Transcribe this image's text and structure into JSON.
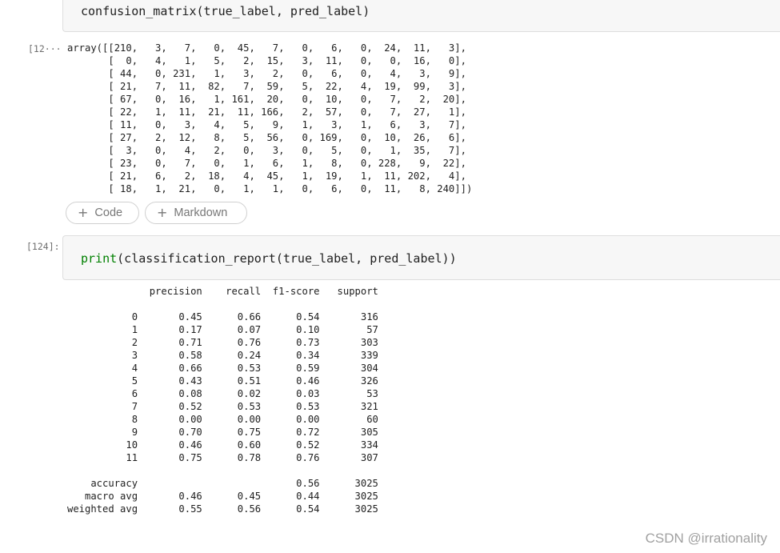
{
  "cell1": {
    "code": "confusion_matrix(true_label, pred_label)",
    "output_prompt": "[12···",
    "output": "array([[210,   3,   7,   0,  45,   7,   0,   6,   0,  24,  11,   3],\n       [  0,   4,   1,   5,   2,  15,   3,  11,   0,   0,  16,   0],\n       [ 44,   0, 231,   1,   3,   2,   0,   6,   0,   4,   3,   9],\n       [ 21,   7,  11,  82,   7,  59,   5,  22,   4,  19,  99,   3],\n       [ 67,   0,  16,   1, 161,  20,   0,  10,   0,   7,   2,  20],\n       [ 22,   1,  11,  21,  11, 166,   2,  57,   0,   7,  27,   1],\n       [ 11,   0,   3,   4,   5,   9,   1,   3,   1,   6,   3,   7],\n       [ 27,   2,  12,   8,   5,  56,   0, 169,   0,  10,  26,   6],\n       [  3,   0,   4,   2,   0,   3,   0,   5,   0,   1,  35,   7],\n       [ 23,   0,   7,   0,   1,   6,   1,   8,   0, 228,   9,  22],\n       [ 21,   6,   2,  18,   4,  45,   1,  19,   1,  11, 202,   4],\n       [ 18,   1,  21,   0,   1,   1,   0,   6,   0,  11,   8, 240]])"
  },
  "add_buttons": {
    "code_label": "Code",
    "markdown_label": "Markdown"
  },
  "cell2": {
    "prompt": "[124]:",
    "code_builtin": "print",
    "code_rest": "(classification_report(true_label, pred_label))",
    "output": "              precision    recall  f1-score   support\n\n           0       0.45      0.66      0.54       316\n           1       0.17      0.07      0.10        57\n           2       0.71      0.76      0.73       303\n           3       0.58      0.24      0.34       339\n           4       0.66      0.53      0.59       304\n           5       0.43      0.51      0.46       326\n           6       0.08      0.02      0.03        53\n           7       0.52      0.53      0.53       321\n           8       0.00      0.00      0.00        60\n           9       0.70      0.75      0.72       305\n          10       0.46      0.60      0.52       334\n          11       0.75      0.78      0.76       307\n\n    accuracy                           0.56      3025\n   macro avg       0.46      0.45      0.44      3025\nweighted avg       0.55      0.56      0.54      3025"
  },
  "watermark": "CSDN @irrationality",
  "icons": {
    "add": "plus-icon"
  },
  "colors": {
    "builtin": "#008000",
    "cell_background": "#f7f7f7"
  }
}
